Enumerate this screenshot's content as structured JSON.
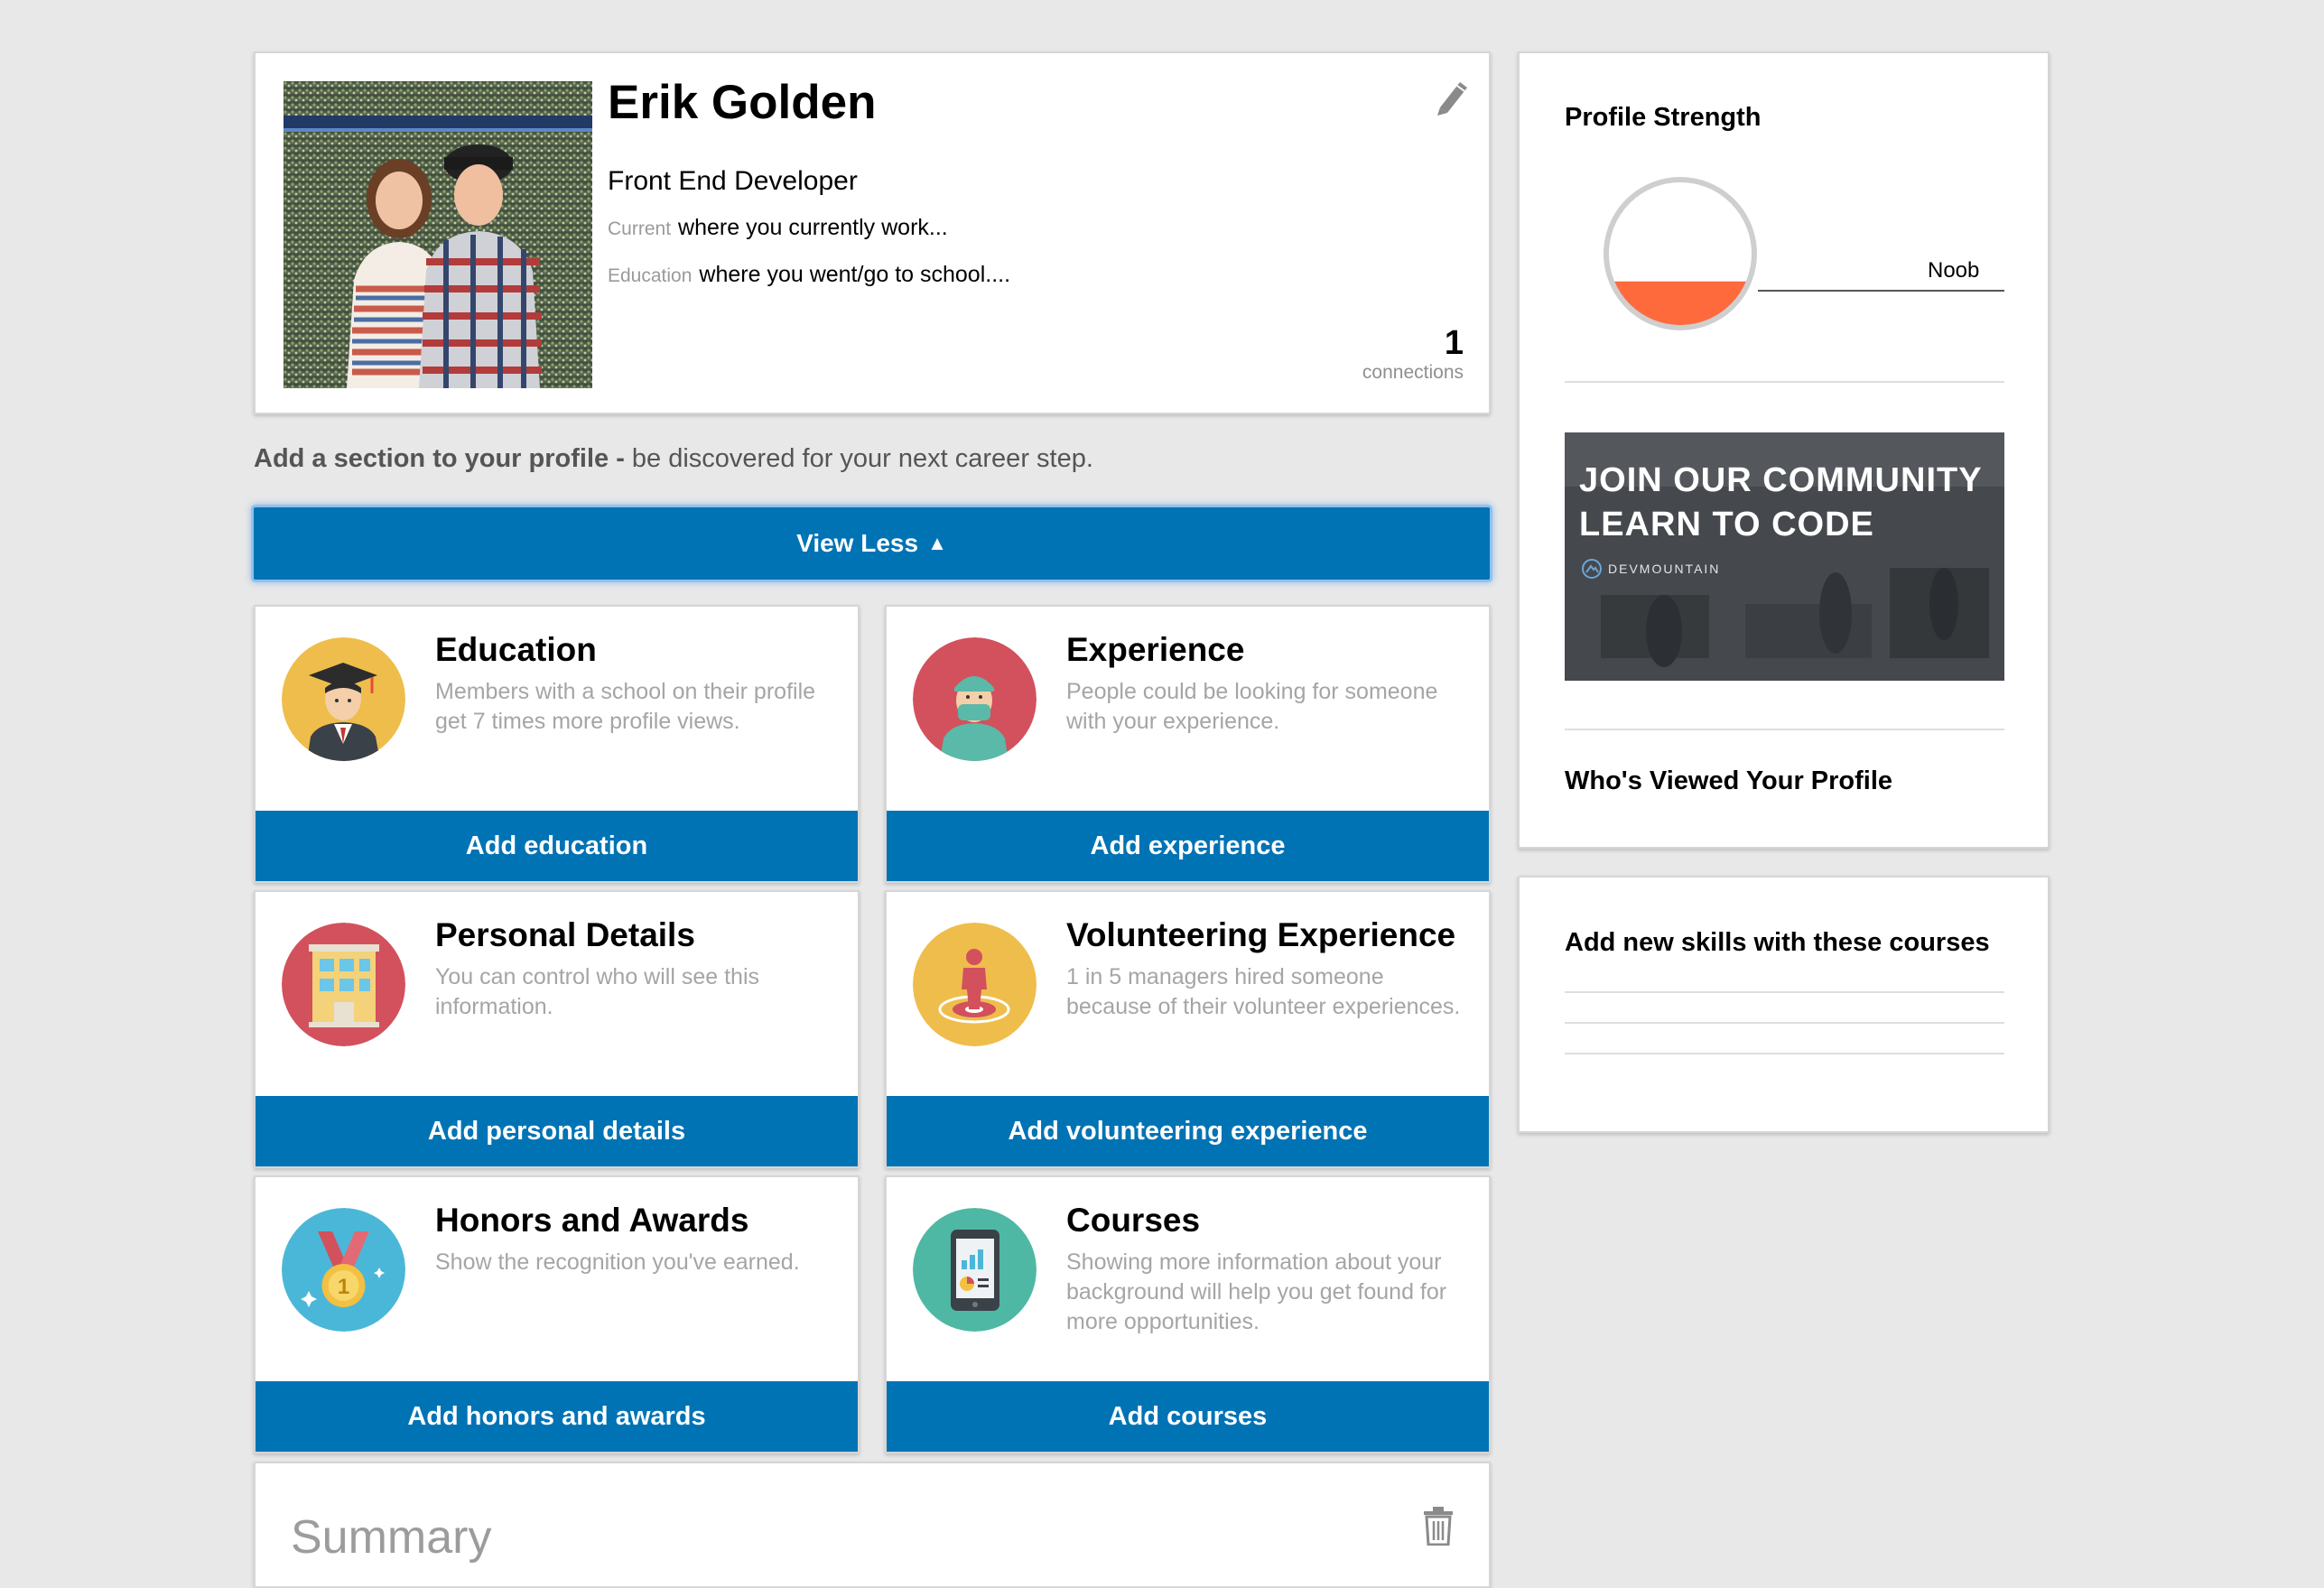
{
  "profile": {
    "name": "Erik Golden",
    "headline": "Front End Developer",
    "current_label": "Current",
    "current_value": "where you currently work...",
    "education_label": "Education",
    "education_value": "where you went/go to school....",
    "connections_count": "1",
    "connections_label": "connections"
  },
  "add_section": {
    "bold": "Add a section to your profile -",
    "rest": " be discovered for your next career step."
  },
  "view_less": {
    "label": "View Less",
    "icon": "triangle-up-icon"
  },
  "sections": [
    {
      "title": "Education",
      "desc": "Members with a school on their profile get 7 times more profile views.",
      "button": "Add education",
      "icon": "graduate-icon",
      "color": "#efbd4b"
    },
    {
      "title": "Experience",
      "desc": "People could be looking for someone with your experience.",
      "button": "Add experience",
      "icon": "surgeon-icon",
      "color": "#d2515d"
    },
    {
      "title": "Personal Details",
      "desc": "You can control who will see this information.",
      "button": "Add personal details",
      "icon": "building-icon",
      "color": "#d2515d"
    },
    {
      "title": "Volunteering Experience",
      "desc": "1 in 5 managers hired someone because of their volunteer experiences.",
      "button": "Add volunteering experience",
      "icon": "person-target-icon",
      "color": "#efbd4b"
    },
    {
      "title": "Honors and Awards",
      "desc": "Show the recognition you've earned.",
      "button": "Add honors and awards",
      "icon": "medal-icon",
      "color": "#4bb7d8"
    },
    {
      "title": "Courses",
      "desc": "Showing more information about your background will help you get found for more opportunities.",
      "button": "Add courses",
      "icon": "tablet-chart-icon",
      "color": "#4fb8a4"
    }
  ],
  "summary": {
    "title": "Summary",
    "icon": "trash-icon"
  },
  "sidebar": {
    "profile_strength_title": "Profile Strength",
    "strength_level": "Noob",
    "strength_fill": 0.28,
    "ad": {
      "line1": "JOIN OUR COMMUNITY",
      "line2": "LEARN TO CODE",
      "brand": "DEVMOUNTAIN"
    },
    "who_viewed_title": "Who's Viewed Your Profile",
    "courses_title": "Add new skills with these courses"
  },
  "colors": {
    "accent": "#0073b5",
    "gauge_fill": "#ff6a3d",
    "background": "#e8e8e8"
  }
}
